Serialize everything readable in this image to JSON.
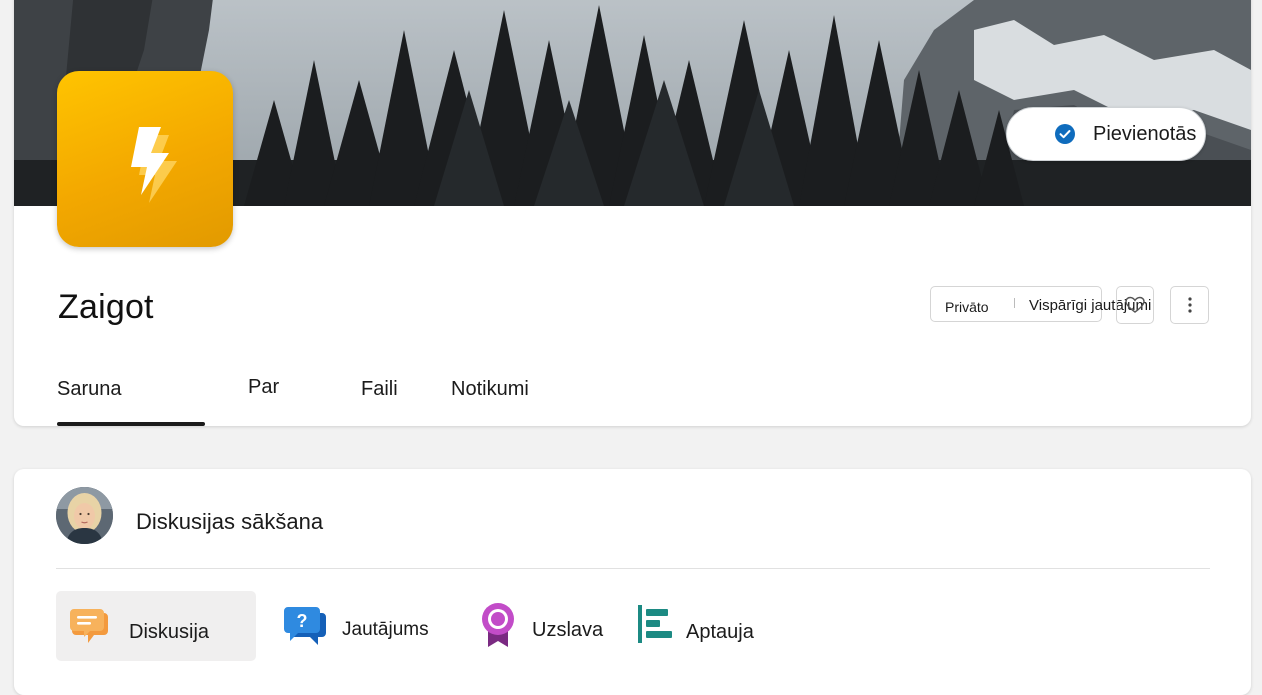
{
  "header": {
    "join_status_label": "Pievienotās",
    "community_name": "Zaigot",
    "privacy": "Privāto",
    "category": "Vispārīgi jautājumi"
  },
  "tabs": [
    {
      "label": "Saruna",
      "selected": true
    },
    {
      "label": "Par"
    },
    {
      "label": "Faili"
    },
    {
      "label": "Notikumi"
    }
  ],
  "composer": {
    "placeholder": "Diskusijas sākšana",
    "post_types": [
      {
        "label": "Diskusija",
        "icon": "discussion-icon",
        "selected": true
      },
      {
        "label": "Jautājums",
        "icon": "question-icon"
      },
      {
        "label": "Uzslava",
        "icon": "praise-icon"
      },
      {
        "label": "Aptauja",
        "icon": "poll-icon"
      }
    ]
  },
  "colors": {
    "accent": "#0f6cbd",
    "logo": "#f5b400",
    "discussion": "#f7943a",
    "question": "#1f7bd6",
    "praise": "#b13bb5",
    "poll": "#1c8a83"
  }
}
